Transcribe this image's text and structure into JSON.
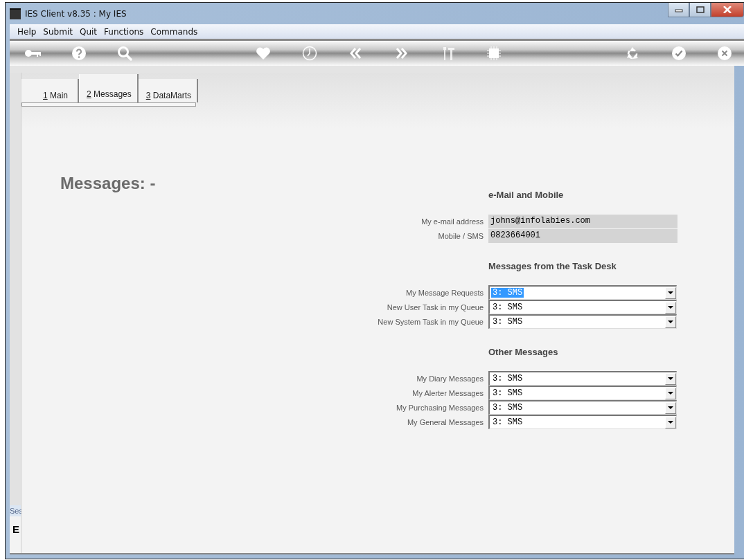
{
  "window": {
    "title": "IES Client v8.35 : My IES"
  },
  "menu": [
    "Help",
    "Submit",
    "Quit",
    "Functions",
    "Commands"
  ],
  "tabs": [
    {
      "mnemonic": "1",
      "label": "Main",
      "selected": false
    },
    {
      "mnemonic": "2",
      "label": "Messages",
      "selected": true
    },
    {
      "mnemonic": "3",
      "label": "DataMarts",
      "selected": false
    }
  ],
  "heading": "Messages: -",
  "sections": [
    {
      "title": "e-Mail and Mobile",
      "fields": [
        {
          "kind": "text",
          "label": "My e-mail address",
          "value": "johns@infolabies.com"
        },
        {
          "kind": "text",
          "label": "Mobile / SMS",
          "value": "0823664001"
        }
      ]
    },
    {
      "title": "Messages from the Task Desk",
      "fields": [
        {
          "kind": "select",
          "label": "My Message Requests",
          "value": "3: SMS",
          "focused": true
        },
        {
          "kind": "select",
          "label": "New User Task in my Queue",
          "value": "3: SMS",
          "focused": false
        },
        {
          "kind": "select",
          "label": "New System Task in my Queue",
          "value": "3: SMS",
          "focused": false
        }
      ]
    },
    {
      "title": "Other Messages",
      "fields": [
        {
          "kind": "select",
          "label": "My Diary Messages",
          "value": "3: SMS",
          "focused": false
        },
        {
          "kind": "select",
          "label": "My Alerter Messages",
          "value": "3: SMS",
          "focused": false
        },
        {
          "kind": "select",
          "label": "My Purchasing Messages",
          "value": "3: SMS",
          "focused": false
        },
        {
          "kind": "select",
          "label": "My General Messages",
          "value": "3: SMS",
          "focused": false
        }
      ]
    }
  ],
  "side_panel": {
    "tab": "Ses",
    "glyph": "E"
  }
}
